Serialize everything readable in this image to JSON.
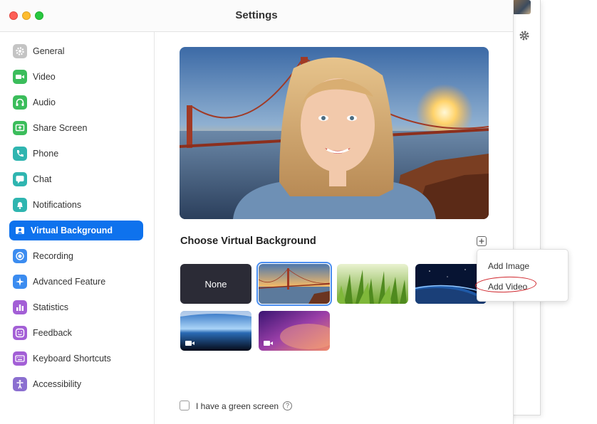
{
  "window": {
    "title": "Settings"
  },
  "sidebar": {
    "items": [
      {
        "label": "General",
        "icon": "gear-icon",
        "color": "#b8b8b8",
        "active": false
      },
      {
        "label": "Video",
        "icon": "video-camera-icon",
        "color": "#3bbd5b",
        "active": false
      },
      {
        "label": "Audio",
        "icon": "headphones-icon",
        "color": "#3bbd5b",
        "active": false
      },
      {
        "label": "Share Screen",
        "icon": "share-screen-icon",
        "color": "#3bbd5b",
        "active": false
      },
      {
        "label": "Phone",
        "icon": "phone-icon",
        "color": "#2fb5b0",
        "active": false
      },
      {
        "label": "Chat",
        "icon": "chat-bubble-icon",
        "color": "#2fb5b0",
        "active": false
      },
      {
        "label": "Notifications",
        "icon": "bell-icon",
        "color": "#2fb5b0",
        "active": false
      },
      {
        "label": "Virtual Background",
        "icon": "person-portrait-icon",
        "color": "#ffffff",
        "active": true
      },
      {
        "label": "Recording",
        "icon": "record-icon",
        "color": "#3b8cf0",
        "active": false
      },
      {
        "label": "Advanced Feature",
        "icon": "sparkle-icon",
        "color": "#3b8cf0",
        "active": false
      },
      {
        "label": "Statistics",
        "icon": "bar-chart-icon",
        "color": "#a35fd6",
        "active": false
      },
      {
        "label": "Feedback",
        "icon": "smiley-icon",
        "color": "#a35fd6",
        "active": false
      },
      {
        "label": "Keyboard Shortcuts",
        "icon": "keyboard-icon",
        "color": "#a35fd6",
        "active": false
      },
      {
        "label": "Accessibility",
        "icon": "accessibility-person-icon",
        "color": "#8b6fd0",
        "active": false
      }
    ]
  },
  "main": {
    "section_title": "Choose Virtual Background",
    "add_button_icon": "plus-icon",
    "thumbnails": [
      {
        "label": "None",
        "kind": "none",
        "selected": false
      },
      {
        "label": "",
        "kind": "golden-gate-bridge",
        "selected": true
      },
      {
        "label": "",
        "kind": "grass",
        "selected": false
      },
      {
        "label": "",
        "kind": "earth-from-space",
        "selected": false
      },
      {
        "label": "",
        "kind": "earth-horizon-video",
        "selected": false,
        "video": true
      },
      {
        "label": "",
        "kind": "aurora-video",
        "selected": false,
        "video": true
      }
    ],
    "menu": {
      "items": [
        "Add Image",
        "Add Video"
      ]
    },
    "green_screen": {
      "label": "I have a green screen",
      "checked": false,
      "help_icon": "question-mark-icon"
    }
  },
  "colors": {
    "accent": "#0e72ed",
    "annotation": "#d0272d"
  }
}
